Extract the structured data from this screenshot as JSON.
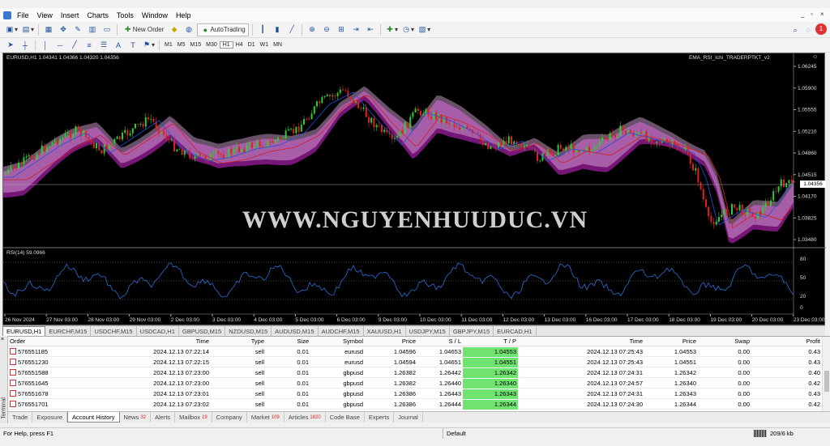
{
  "menu": [
    "File",
    "View",
    "Insert",
    "Charts",
    "Tools",
    "Window",
    "Help"
  ],
  "toolbar": {
    "new_order": "New Order",
    "auto_trading": "AutoTrading"
  },
  "timeframes": [
    "M1",
    "M5",
    "M15",
    "M30",
    "H1",
    "H4",
    "D1",
    "W1",
    "MN"
  ],
  "chart": {
    "symbol_label": "EURUSD,H1  1.04341 1.04366 1.04320 1.04356",
    "indicator_label": "EMA_RSI_Ichi_TRADERPTKT_v2",
    "rsi_label": "RSI(14) 59.0966",
    "current_price": "1.04356",
    "price_ticks": [
      "1.06245",
      "1.05900",
      "1.05555",
      "1.05210",
      "1.04860",
      "1.04515",
      "1.04170",
      "1.03825",
      "1.03480"
    ],
    "rsi_ticks": [
      "80",
      "50",
      "20",
      "0"
    ],
    "time_ticks": [
      "26 Nov 2024",
      "27 Nov 03:00",
      "28 Nov 03:00",
      "29 Nov 03:00",
      "2 Dec 03:00",
      "3 Dec 03:00",
      "4 Dec 03:00",
      "5 Dec 03:00",
      "6 Dec 03:00",
      "9 Dec 03:00",
      "10 Dec 03:00",
      "11 Dec 03:00",
      "12 Dec 03:00",
      "13 Dec 03:00",
      "16 Dec 03:00",
      "17 Dec 03:00",
      "18 Dec 03:00",
      "19 Dec 03:00",
      "20 Dec 03:00",
      "23 Dec 03:00"
    ],
    "watermark": "WWW.NGUYENHUUDUC.VN",
    "colors": {
      "bull": "#2ecc2e",
      "bear": "#e02020",
      "cloud_bear": "#8b1a8b",
      "cloud_bull": "#e6b3e6",
      "rsi": "#2b6fd6"
    }
  },
  "chart_tabs": [
    "EURUSD,H1",
    "EURCHF,M15",
    "USDCHF,M15",
    "USDCAD,H1",
    "GBPUSD,M15",
    "NZDUSD,M15",
    "AUDUSD,M15",
    "AUDCHF,M15",
    "XAUUSD,H1",
    "USDJPY,M15",
    "GBPJPY,M15",
    "EURCAD,H1"
  ],
  "terminal": {
    "label": "Terminal",
    "columns": [
      "Order",
      "Time",
      "Type",
      "Size",
      "Symbol",
      "Price",
      "S / L",
      "T / P",
      "Time",
      "Price",
      "Swap",
      "Profit"
    ],
    "rows": [
      [
        "576551185",
        "2024.12.13 07:22:14",
        "sell",
        "0.01",
        "eurusd",
        "1.04596",
        "1.04653",
        "1.04553",
        "2024.12.13 07:25:43",
        "1.04553",
        "0.00",
        "0.43"
      ],
      [
        "576551230",
        "2024.12.13 07:22:15",
        "sell",
        "0.01",
        "eurusd",
        "1.04594",
        "1.04651",
        "1.04551",
        "2024.12.13 07:25:43",
        "1.04551",
        "0.00",
        "0.43"
      ],
      [
        "576551588",
        "2024.12.13 07:23:00",
        "sell",
        "0.01",
        "gbpusd",
        "1.26382",
        "1.26442",
        "1.26342",
        "2024.12.13 07:24:31",
        "1.26342",
        "0.00",
        "0.40"
      ],
      [
        "576551645",
        "2024.12.13 07:23:00",
        "sell",
        "0.01",
        "gbpusd",
        "1.26382",
        "1.26440",
        "1.26340",
        "2024.12.13 07:24:57",
        "1.26340",
        "0.00",
        "0.42"
      ],
      [
        "576551678",
        "2024.12.13 07:23:01",
        "sell",
        "0.01",
        "gbpusd",
        "1.26386",
        "1.26443",
        "1.26343",
        "2024.12.13 07:24:31",
        "1.26343",
        "0.00",
        "0.43"
      ],
      [
        "576551701",
        "2024.12.13 07:23:02",
        "sell",
        "0.01",
        "gbpusd",
        "1.26386",
        "1.26444",
        "1.26344",
        "2024.12.13 07:24:30",
        "1.26344",
        "0.00",
        "0.42"
      ]
    ]
  },
  "bottom_tabs": [
    {
      "label": "Trade",
      "badge": ""
    },
    {
      "label": "Exposure",
      "badge": ""
    },
    {
      "label": "Account History",
      "badge": ""
    },
    {
      "label": "News",
      "badge": "32"
    },
    {
      "label": "Alerts",
      "badge": ""
    },
    {
      "label": "Mailbox",
      "badge": "19"
    },
    {
      "label": "Company",
      "badge": ""
    },
    {
      "label": "Market",
      "badge": "109"
    },
    {
      "label": "Articles",
      "badge": "1820"
    },
    {
      "label": "Code Base",
      "badge": ""
    },
    {
      "label": "Experts",
      "badge": ""
    },
    {
      "label": "Journal",
      "badge": ""
    }
  ],
  "status": {
    "help": "For Help, press F1",
    "profile": "Default",
    "traffic": "209/6 kb"
  },
  "notification_count": "1"
}
